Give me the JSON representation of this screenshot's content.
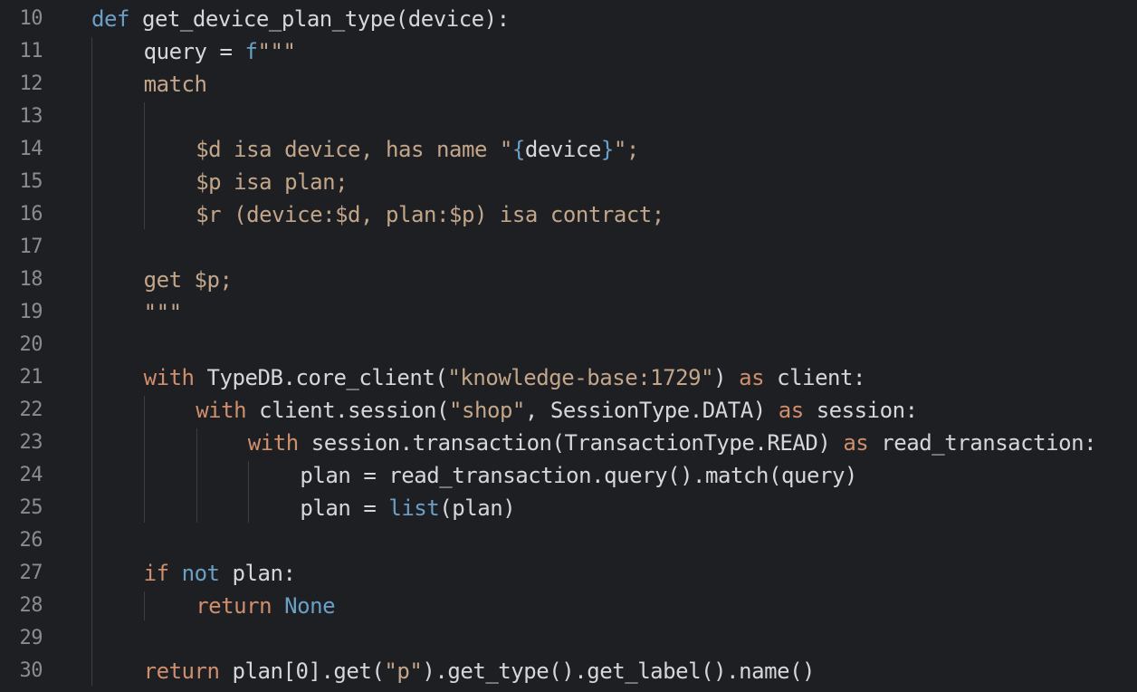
{
  "editor": {
    "colors": {
      "background": "#1e1f22",
      "line_number": "#8a8c90",
      "text": "#bcbec4",
      "keyword": "#cf8e6d",
      "def_keyword": "#6aa0c8",
      "builtin": "#56a8f5",
      "string": "#6aab73",
      "query_text": "#c3a68a",
      "indent_guide": "#3c3e43"
    },
    "lines": [
      {
        "number": "10",
        "indent": 0,
        "tokens": [
          {
            "t": "def",
            "c": "def"
          },
          {
            "t": " get_device_plan_type(device):",
            "c": "name"
          }
        ]
      },
      {
        "number": "11",
        "indent": 4,
        "tokens": [
          {
            "t": "query = ",
            "c": "name"
          },
          {
            "t": "f",
            "c": "def"
          },
          {
            "t": "\"\"\"",
            "c": "tq"
          }
        ]
      },
      {
        "number": "12",
        "indent": 4,
        "tokens": [
          {
            "t": "match",
            "c": "tq"
          }
        ]
      },
      {
        "number": "13",
        "indent": 0,
        "tokens": []
      },
      {
        "number": "14",
        "indent": 8,
        "tokens": [
          {
            "t": "$d isa device, has name \"",
            "c": "tq"
          },
          {
            "t": "{",
            "c": "def"
          },
          {
            "t": "device",
            "c": "name"
          },
          {
            "t": "}",
            "c": "def"
          },
          {
            "t": "\";",
            "c": "tq"
          }
        ]
      },
      {
        "number": "15",
        "indent": 8,
        "tokens": [
          {
            "t": "$p isa plan;",
            "c": "tq"
          }
        ]
      },
      {
        "number": "16",
        "indent": 8,
        "tokens": [
          {
            "t": "$r (device:$d, plan:$p) isa contract;",
            "c": "tq"
          }
        ]
      },
      {
        "number": "17",
        "indent": 0,
        "tokens": []
      },
      {
        "number": "18",
        "indent": 4,
        "tokens": [
          {
            "t": "get $p;",
            "c": "tq"
          }
        ]
      },
      {
        "number": "19",
        "indent": 4,
        "tokens": [
          {
            "t": "\"\"\"",
            "c": "tq"
          }
        ]
      },
      {
        "number": "20",
        "indent": 0,
        "tokens": []
      },
      {
        "number": "21",
        "indent": 4,
        "tokens": [
          {
            "t": "with",
            "c": "kw"
          },
          {
            "t": " TypeDB.core_client(",
            "c": "name"
          },
          {
            "t": "\"knowledge-base:1729\"",
            "c": "tq"
          },
          {
            "t": ") ",
            "c": "name"
          },
          {
            "t": "as",
            "c": "kw"
          },
          {
            "t": " client:",
            "c": "name"
          }
        ]
      },
      {
        "number": "22",
        "indent": 8,
        "tokens": [
          {
            "t": "with",
            "c": "kw"
          },
          {
            "t": " client.session(",
            "c": "name"
          },
          {
            "t": "\"shop\"",
            "c": "tq"
          },
          {
            "t": ", SessionType.DATA) ",
            "c": "name"
          },
          {
            "t": "as",
            "c": "kw"
          },
          {
            "t": " session:",
            "c": "name"
          }
        ]
      },
      {
        "number": "23",
        "indent": 12,
        "tokens": [
          {
            "t": "with",
            "c": "kw"
          },
          {
            "t": " session.transaction(TransactionType.READ) ",
            "c": "name"
          },
          {
            "t": "as",
            "c": "kw"
          },
          {
            "t": " read_transaction:",
            "c": "name"
          }
        ]
      },
      {
        "number": "24",
        "indent": 16,
        "tokens": [
          {
            "t": "plan = read_transaction.query().match(query)",
            "c": "name"
          }
        ]
      },
      {
        "number": "25",
        "indent": 16,
        "tokens": [
          {
            "t": "plan = ",
            "c": "name"
          },
          {
            "t": "list",
            "c": "def"
          },
          {
            "t": "(plan)",
            "c": "name"
          }
        ]
      },
      {
        "number": "26",
        "indent": 0,
        "tokens": []
      },
      {
        "number": "27",
        "indent": 4,
        "tokens": [
          {
            "t": "if",
            "c": "kw"
          },
          {
            "t": " ",
            "c": "name"
          },
          {
            "t": "not",
            "c": "def"
          },
          {
            "t": " plan:",
            "c": "name"
          }
        ]
      },
      {
        "number": "28",
        "indent": 8,
        "tokens": [
          {
            "t": "return",
            "c": "kw"
          },
          {
            "t": " ",
            "c": "name"
          },
          {
            "t": "None",
            "c": "def"
          }
        ]
      },
      {
        "number": "29",
        "indent": 0,
        "tokens": []
      },
      {
        "number": "30",
        "indent": 4,
        "tokens": [
          {
            "t": "return",
            "c": "kw"
          },
          {
            "t": " plan[0].get(",
            "c": "name"
          },
          {
            "t": "\"p\"",
            "c": "tq"
          },
          {
            "t": ").get_type().get_label().name()",
            "c": "name"
          }
        ]
      }
    ]
  }
}
